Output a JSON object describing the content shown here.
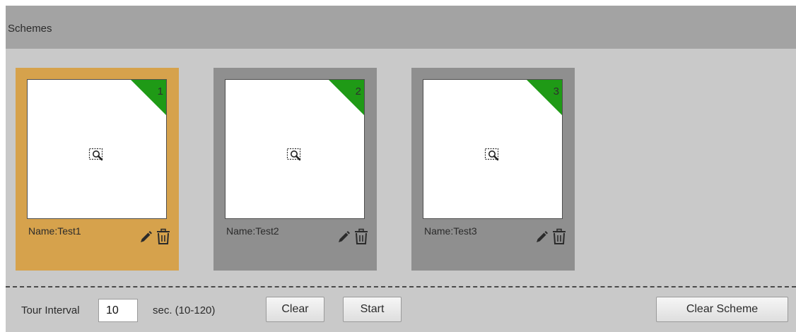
{
  "header": {
    "title": "Schemes"
  },
  "schemes": [
    {
      "number": "1",
      "name": "Name:Test1",
      "selected": true
    },
    {
      "number": "2",
      "name": "Name:Test2",
      "selected": false
    },
    {
      "number": "3",
      "name": "Name:Test3",
      "selected": false
    }
  ],
  "controls": {
    "tour_interval_label": "Tour Interval",
    "tour_interval_value": "10",
    "range_label": "sec. (10-120)",
    "clear_label": "Clear",
    "start_label": "Start",
    "clear_scheme_label": "Clear Scheme"
  },
  "colors": {
    "selected_card": "#d6a24c",
    "card": "#8f8f8f",
    "corner_badge": "#1f9a16",
    "panel": "#c9c9c9",
    "header": "#a3a3a3"
  },
  "icons": {
    "thumbnail": "zoom-icon",
    "edit": "pencil-icon",
    "delete": "trash-icon"
  }
}
